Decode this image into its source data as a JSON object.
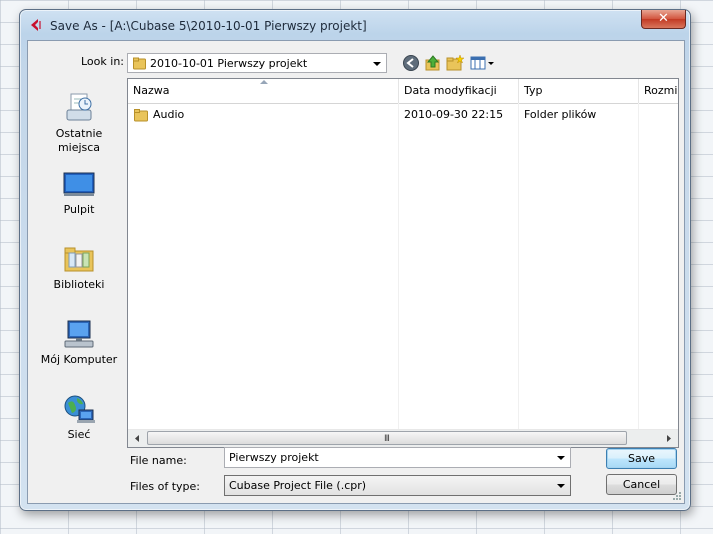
{
  "window": {
    "title": "Save As - [A:\\Cubase 5\\2010-10-01 Pierwszy projekt]",
    "close_glyph": "✕"
  },
  "toolbar": {
    "look_in_label": "Look in:",
    "look_in_value": "2010-10-01 Pierwszy projekt",
    "icons": [
      "back-icon",
      "up-folder-icon",
      "new-folder-icon",
      "view-menu-icon"
    ]
  },
  "places": [
    {
      "label": "Ostatnie miejsca",
      "icon": "recent-places-icon"
    },
    {
      "label": "Pulpit",
      "icon": "desktop-icon"
    },
    {
      "label": "Biblioteki",
      "icon": "libraries-icon"
    },
    {
      "label": "Mój Komputer",
      "icon": "computer-icon"
    },
    {
      "label": "Sieć",
      "icon": "network-icon"
    }
  ],
  "file_list": {
    "columns": [
      "Nazwa",
      "Data modyfikacji",
      "Typ",
      "Rozmi"
    ],
    "rows": [
      {
        "name": "Audio",
        "modified": "2010-09-30 22:15",
        "type": "Folder plików"
      }
    ],
    "scrollbar_grip": "III"
  },
  "form": {
    "file_name_label": "File name:",
    "file_name_value": "Pierwszy projekt",
    "file_type_label": "Files of type:",
    "file_type_value": "Cubase Project File (.cpr)",
    "save_label": "Save",
    "cancel_label": "Cancel"
  },
  "colors": {
    "accent": "#3c7fb1",
    "folder": "#e9c45a",
    "close": "#c23a24"
  }
}
